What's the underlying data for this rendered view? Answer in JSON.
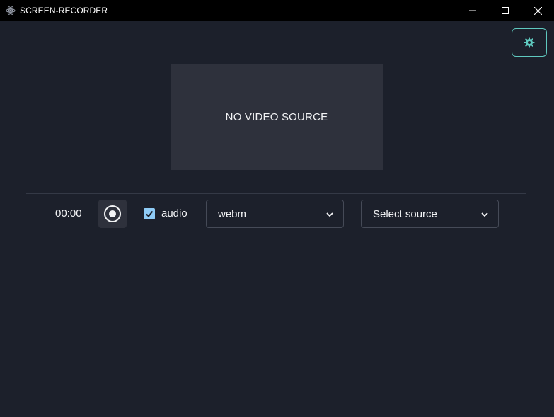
{
  "window": {
    "title": "SCREEN-RECORDER"
  },
  "preview": {
    "placeholder": "NO VIDEO SOURCE"
  },
  "controls": {
    "timer": "00:00",
    "audio_label": "audio",
    "audio_checked": true,
    "format_value": "webm",
    "source_value": "Select source"
  },
  "icons": {
    "app": "electron-icon",
    "settings": "gear-icon",
    "record": "record-icon",
    "minimize": "minimize-icon",
    "maximize": "maximize-icon",
    "close": "close-icon",
    "dropdown": "chevron-down-icon"
  },
  "colors": {
    "background": "#1c202b",
    "titlebar": "#000000",
    "accent": "#5fc9bf",
    "checkbox": "#8ecbf6",
    "panel": "#2e313c"
  }
}
